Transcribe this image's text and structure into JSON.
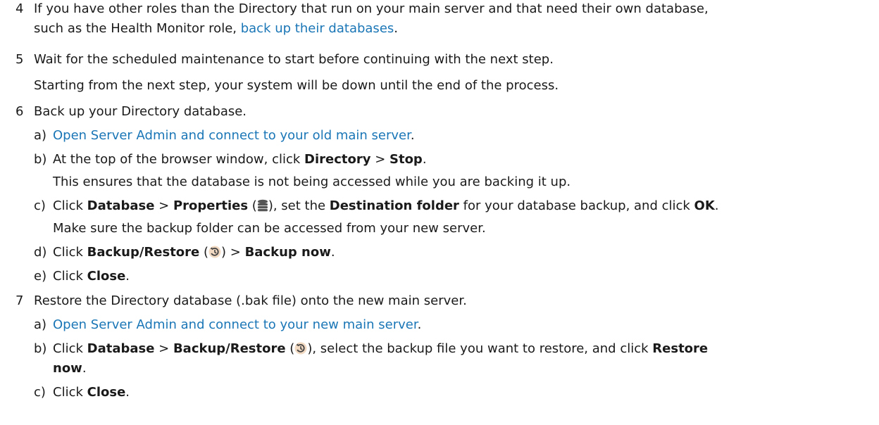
{
  "steps": [
    {
      "num": "4",
      "line1_pre": "If you have other roles than the Directory that run on your main server and that need their own database,",
      "line2_pre": "such as the Health Monitor role, ",
      "line2_link": "back up their databases",
      "line2_post": "."
    },
    {
      "num": "5",
      "text": "Wait for the scheduled maintenance to start before continuing with the next step.",
      "note": "Starting from the next step, your system will be down until the end of the process."
    },
    {
      "num": "6",
      "text": "Back up your Directory database.",
      "subs": [
        {
          "label": "a)",
          "link": "Open Server Admin and connect to your old main server",
          "post": "."
        },
        {
          "label": "b)",
          "pre": "At the top of the browser window, click ",
          "b1": "Directory",
          "mid": " > ",
          "b2": "Stop",
          "post": ".",
          "note": "This ensures that the database is not being accessed while you are backing it up."
        },
        {
          "label": "c)",
          "pre": "Click ",
          "b1": "Database",
          "mid": " > ",
          "b2": "Properties",
          "mid2": " (",
          "mid3": "), set the ",
          "b3": "Destination folder",
          "mid4": " for your database backup, and click ",
          "b4": "OK",
          "post": ".",
          "note": "Make sure the backup folder can be accessed from your new server."
        },
        {
          "label": "d)",
          "pre": "Click ",
          "b1": "Backup/Restore",
          "mid": " (",
          "mid2": ") > ",
          "b2": "Backup now",
          "post": "."
        },
        {
          "label": "e)",
          "pre": "Click ",
          "b1": "Close",
          "post": "."
        }
      ]
    },
    {
      "num": "7",
      "text": "Restore the Directory database (.bak file) onto the new main server.",
      "subs": [
        {
          "label": "a)",
          "link": "Open Server Admin and connect to your new main server",
          "post": "."
        },
        {
          "label": "b)",
          "pre": "Click ",
          "b1": "Database",
          "mid": " > ",
          "b2": "Backup/Restore",
          "mid2": " (",
          "mid3": "), select the backup file you want to restore, and click ",
          "b3": "Restore",
          "line2_b": "now",
          "post": "."
        },
        {
          "label": "c)",
          "pre": "Click ",
          "b1": "Close",
          "post": "."
        }
      ]
    }
  ],
  "icons": {
    "properties": "database-properties-icon",
    "backup_restore": "backup-restore-icon"
  },
  "colors": {
    "link": "#1a76b6",
    "text": "#1a1a1a"
  }
}
